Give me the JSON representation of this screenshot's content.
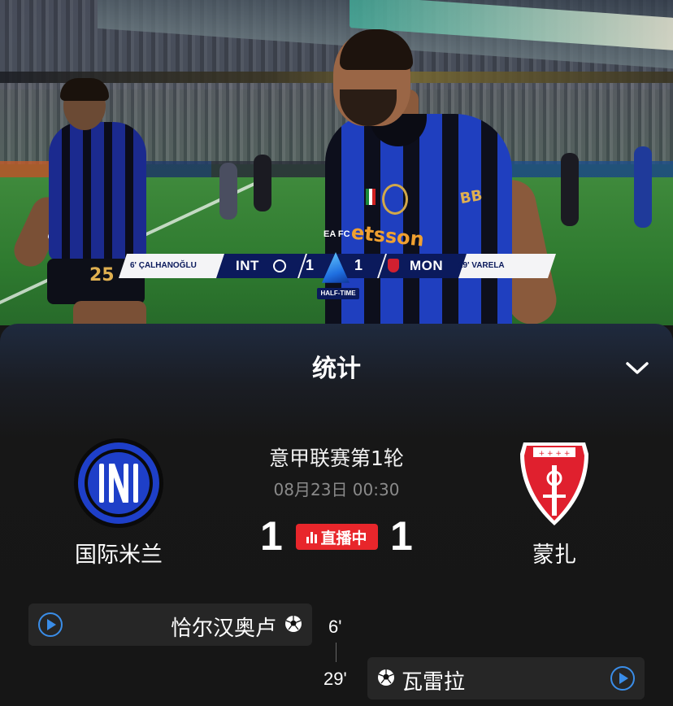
{
  "scorebug": {
    "home_scorer": "6' ÇALHANOĞLU",
    "home_abbr": "INT",
    "home_score": "1",
    "away_score": "1",
    "away_abbr": "MON",
    "away_scorer": "29' VARELA",
    "period": "HALF-TIME",
    "broadcaster": "EA FC"
  },
  "video_text": {
    "sponsor": "etsson",
    "shirt_text": "BB",
    "shirt_number": "25"
  },
  "panel": {
    "title": "统计",
    "collapse_icon": "chevron-down-icon"
  },
  "match": {
    "league_round": "意甲联赛第1轮",
    "datetime": "08月23日 00:30",
    "home_team": "国际米兰",
    "away_team": "蒙扎",
    "home_score": "1",
    "away_score": "1",
    "live_label": "直播中",
    "live_color": "#e8262b"
  },
  "events": [
    {
      "side": "home",
      "player": "恰尔汉奥卢",
      "minute": "6'",
      "icon": "soccer-ball-icon"
    },
    {
      "side": "away",
      "player": "瓦雷拉",
      "minute": "29'",
      "icon": "soccer-ball-icon"
    }
  ],
  "colors": {
    "inter_blue": "#1f3fbf",
    "monza_red": "#d02030",
    "accent_blue": "#3a8de8"
  }
}
